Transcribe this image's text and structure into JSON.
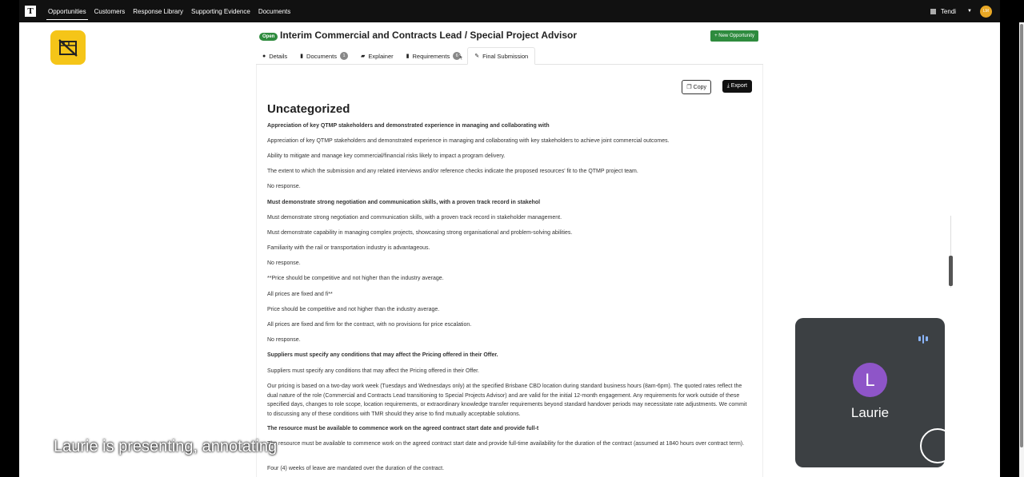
{
  "nav": {
    "logo": "T",
    "items": [
      "Opportunities",
      "Customers",
      "Response Library",
      "Supporting Evidence",
      "Documents"
    ],
    "user": "Tendi",
    "avatar_initials": "LM"
  },
  "header": {
    "status": "Open",
    "title": "Interim Commercial and Contracts Lead / Special Project Advisor",
    "new_button": "+ New Opportunity"
  },
  "tabs": [
    {
      "label": "Details",
      "icon": "info-icon"
    },
    {
      "label": "Documents",
      "icon": "document-icon",
      "count": "1"
    },
    {
      "label": "Explainer",
      "icon": "book-icon"
    },
    {
      "label": "Requirements",
      "icon": "clipboard-icon",
      "count": "6"
    },
    {
      "label": "Final Submission",
      "icon": "pen-icon"
    }
  ],
  "actions": {
    "copy": "Copy",
    "export": "Export"
  },
  "section_heading": "Uncategorized",
  "lines": [
    {
      "t": "Appreciation of key QTMP stakeholders and demonstrated experience in managing and collaborating with",
      "b": true
    },
    {
      "t": "Appreciation of key QTMP stakeholders and demonstrated experience in managing and collaborating with key stakeholders to achieve joint commercial outcomes."
    },
    {
      "t": "Ability to mitigate and manage key commercial/financial risks likely to impact a program delivery."
    },
    {
      "t": "The extent to which the submission and any related interviews and/or reference checks indicate the proposed resources' fit to the QTMP project team."
    },
    {
      "t": "No response."
    },
    {
      "t": "Must demonstrate strong negotiation and communication skills, with a proven track record in stakehol",
      "b": true
    },
    {
      "t": "Must demonstrate strong negotiation and communication skills, with a proven track record in stakeholder management."
    },
    {
      "t": "Must demonstrate capability in managing complex projects, showcasing strong organisational and problem-solving abilities."
    },
    {
      "t": "Familiarity with the rail or transportation industry is advantageous."
    },
    {
      "t": "No response."
    },
    {
      "t": "**Price should be competitive and not higher than the industry average."
    },
    {
      "t": "All prices are fixed and fi**"
    },
    {
      "t": "Price should be competitive and not higher than the industry average."
    },
    {
      "t": "All prices are fixed and firm for the contract, with no provisions for price escalation."
    },
    {
      "t": "No response."
    },
    {
      "t": "Suppliers must specify any conditions that may affect the Pricing offered in their Offer.",
      "b": true
    },
    {
      "t": "Suppliers must specify any conditions that may affect the Pricing offered in their Offer."
    },
    {
      "t": "Our pricing is based on a two-day work week (Tuesdays and Wednesdays only) at the specified Brisbane CBD location during standard business hours (8am-6pm). The quoted rates reflect the dual nature of the role (Commercial and Contracts Lead transitioning to Special Projects Advisor) and are valid for the initial 12-month engagement. Any requirements for work outside of these specified days, changes to role scope, location requirements, or extraordinary knowledge transfer requirements beyond standard handover periods may necessitate rate adjustments. We commit to discussing any of these conditions with TMR should they arise to find mutually acceptable solutions."
    },
    {
      "t": "The resource must be available to commence work on the agreed contract start date and provide full-t",
      "b": true
    },
    {
      "t": "The resource must be available to commence work on the agreed contract start date and provide full-time availability for the duration of the contract (assumed at 1840 hours over contract term)."
    },
    {
      "t": "Four (4) weeks of leave are mandated over the duration of the contract."
    }
  ],
  "presenter": {
    "initial": "L",
    "name": "Laurie"
  },
  "caption": "Laurie is presenting, annotating"
}
